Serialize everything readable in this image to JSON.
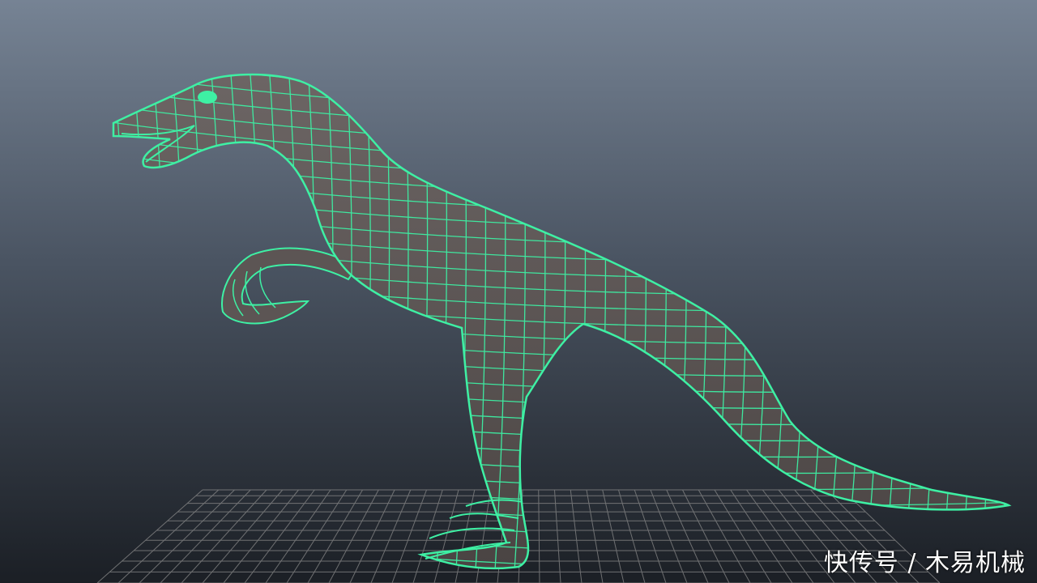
{
  "scene": {
    "subject": "dinosaur-wireframe-model",
    "background_top_color": "#768394",
    "background_bottom_color": "#1b1f25",
    "mesh_fill_color": "#5a5352",
    "mesh_wire_color": "#3ef0a4",
    "grid_color": "#8a8a8a"
  },
  "watermark": {
    "text": "快传号 / 木易机械"
  }
}
